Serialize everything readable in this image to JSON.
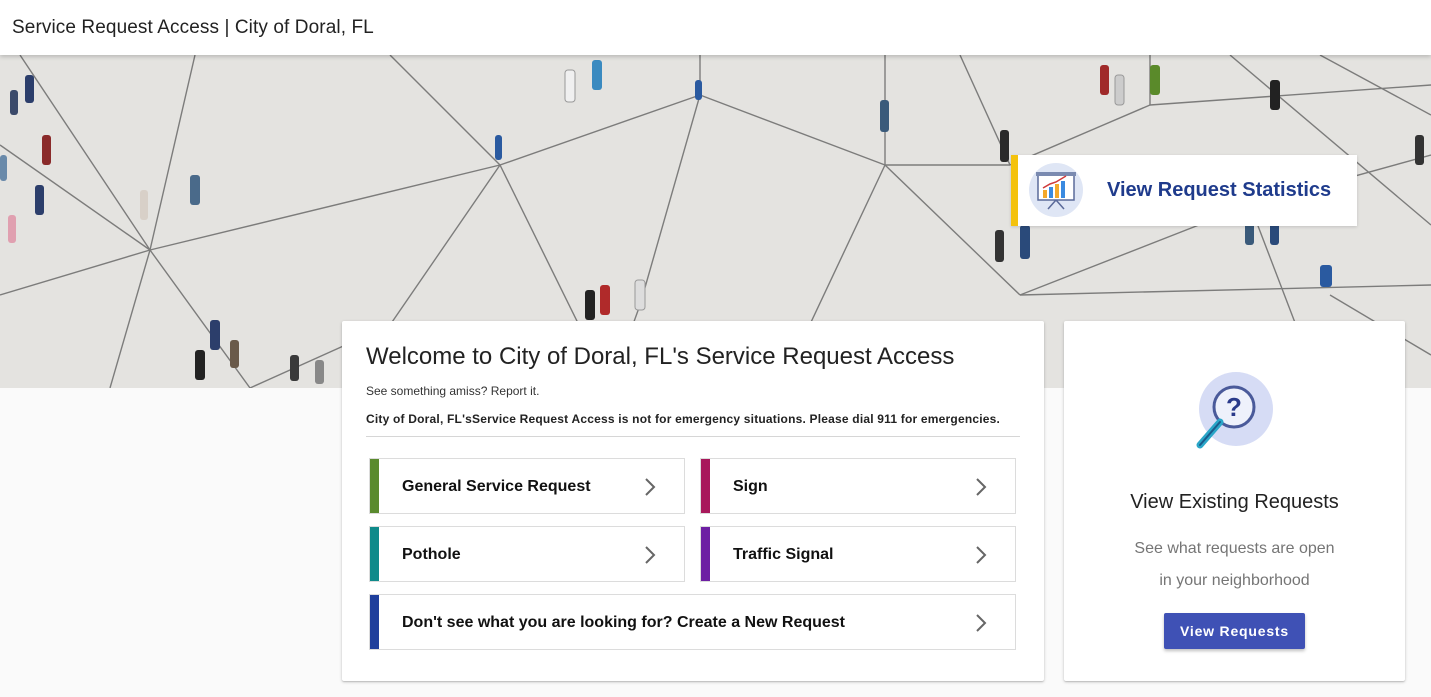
{
  "header": {
    "title": "Service Request Access | City of Doral, FL"
  },
  "stats_link": {
    "label": "View Request Statistics",
    "icon": "bar-chart-icon",
    "accent_color": "#f4c20d"
  },
  "welcome": {
    "title": "Welcome to City of Doral, FL's Service Request Access",
    "subtitle": "See something amiss? Report it.",
    "warning": "City of Doral, FL'sService Request Access is not for emergency situations. Please dial 911 for emergencies."
  },
  "request_types": [
    {
      "label": "General Service Request",
      "color": "#5a8a2e"
    },
    {
      "label": "Sign",
      "color": "#a8185b"
    },
    {
      "label": "Pothole",
      "color": "#0f8a8a"
    },
    {
      "label": "Traffic Signal",
      "color": "#6d1fa3"
    },
    {
      "label": "Don't see what you are looking for? Create a New Request",
      "color": "#1f3f9c"
    }
  ],
  "existing": {
    "title": "View Existing Requests",
    "desc_line1": "See what requests are open",
    "desc_line2": "in your neighborhood",
    "button_label": "View Requests",
    "icon": "magnifier-question-icon",
    "button_color": "#3f51b5"
  }
}
